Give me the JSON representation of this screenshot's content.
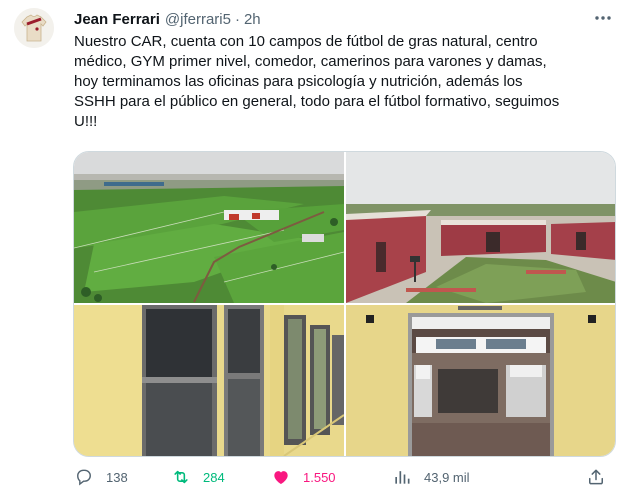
{
  "tweet": {
    "author_name": "Jean Ferrari",
    "author_handle": "@jferrari5",
    "separator": "·",
    "timestamp": "2h",
    "text_lines": [
      "Nuestro CAR, cuenta con 10 campos de fútbol de gras natural, centro",
      "médico, GYM primer nivel, comedor, camerinos para varones y damas,",
      "hoy terminamos las oficinas para psicología y nutrición, además los",
      "SSHH para el público en general, todo para el fútbol formativo, seguimos",
      "U!!!"
    ],
    "media": [
      {
        "icon": "aerial-football-fields-photo"
      },
      {
        "icon": "red-buildings-courtyard-photo"
      },
      {
        "icon": "glass-door-hallway-photo"
      },
      {
        "icon": "restroom-interior-photo"
      }
    ],
    "actions": {
      "replies": "138",
      "retweets": "284",
      "likes": "1.550",
      "views": "43,9 mil"
    },
    "colors": {
      "text": "#0f1419",
      "secondary": "#536471",
      "retweet": "#00ba7c",
      "like": "#f91880",
      "border": "#cfd9de"
    }
  }
}
